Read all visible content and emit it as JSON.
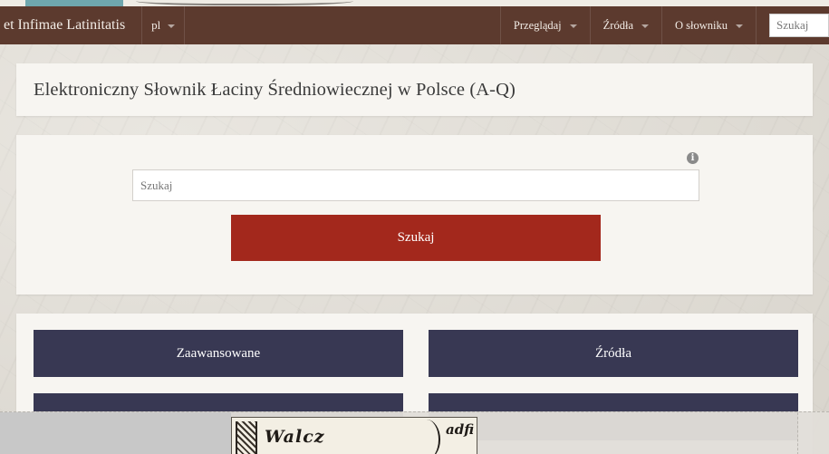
{
  "navbar": {
    "brand": "et Infimae Latinitatis",
    "language": "pl",
    "menu": [
      {
        "label": "Przeglądaj"
      },
      {
        "label": "Źródła"
      },
      {
        "label": "O słowniku"
      }
    ],
    "search_placeholder": "Szukaj"
  },
  "page": {
    "title": "Elektroniczny Słownik Łaciny Średniowiecznej w Polsce (A-Q)"
  },
  "search": {
    "placeholder": "Szukaj",
    "button_label": "Szukaj",
    "info_glyph": "i"
  },
  "links": [
    {
      "label": "Zaawansowane"
    },
    {
      "label": "Źródła"
    },
    {
      "label": ""
    },
    {
      "label": ""
    }
  ],
  "colors": {
    "navbar": "#5c3a2e",
    "search_button": "#a3281c",
    "link_button": "#383853",
    "panel": "#f7f5f1"
  },
  "scan_fragment": {
    "word_left": "Walcz",
    "word_right": "adfi"
  }
}
